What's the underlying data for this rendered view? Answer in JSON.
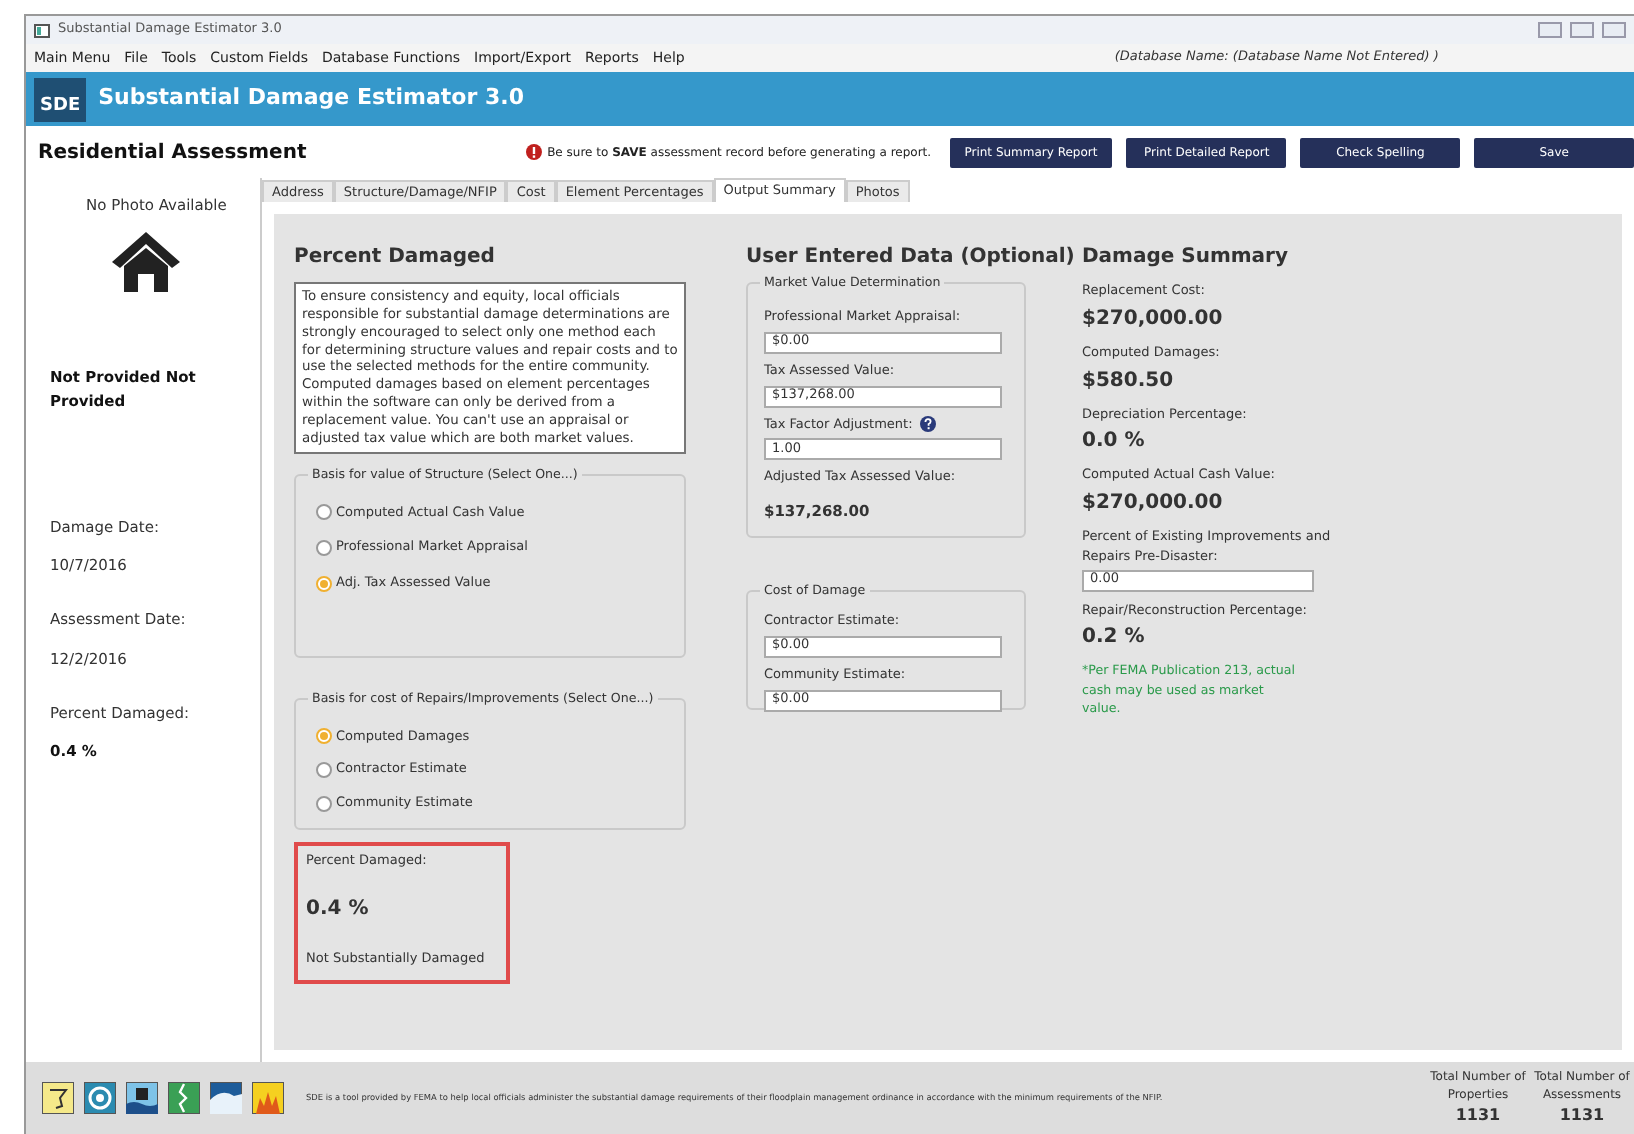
{
  "window": {
    "title": "Substantial Damage Estimator 3.0"
  },
  "menu": [
    "Main Menu",
    "File",
    "Tools",
    "Custom Fields",
    "Database Functions",
    "Import/Export",
    "Reports",
    "Help"
  ],
  "database_name": "(Database Name:  (Database Name Not Entered) )",
  "header": {
    "logo": "SDE",
    "title": "Substantial Damage Estimator 3.0"
  },
  "assessment": {
    "title": "Residential Assessment",
    "warning": "Be sure to **SAVE** assessment record before generating a report.",
    "buttons": [
      "Print Summary Report",
      "Print Detailed Report",
      "Check Spelling",
      "Save"
    ]
  },
  "tabs": [
    {
      "label": "Address",
      "selected": false
    },
    {
      "label": "Structure/Damage/NFIP",
      "selected": false
    },
    {
      "label": "Cost",
      "selected": false
    },
    {
      "label": "Element Percentages",
      "selected": false
    },
    {
      "label": "Output Summary",
      "selected": true
    },
    {
      "label": "Photos",
      "selected": false
    }
  ],
  "sidebar": {
    "photo_label": "No Photo Available",
    "owner": "Not Provided Not Provided",
    "fields": [
      {
        "label": "Damage Date:",
        "value": "10/7/2016",
        "bold": false
      },
      {
        "label": "Assessment Date:",
        "value": "12/2/2016",
        "bold": false
      },
      {
        "label": "Percent Damaged:",
        "value": "0.4 %",
        "bold": true
      }
    ]
  },
  "percent_damaged": {
    "heading": "Percent Damaged",
    "info": "To ensure consistency and equity, local officials responsible for substantial damage determinations are strongly encouraged to select only one method each for determining structure values and repair costs and to use the selected methods for the entire community. Computed damages based on element percentages within the software can only be derived from a replacement value. You can't use an appraisal or adjusted tax value which are both market values.",
    "groups": [
      {
        "legend": "Basis for value of Structure (Select One...)",
        "options": [
          {
            "label": "Computed Actual Cash Value",
            "selected": false
          },
          {
            "label": "Professional Market Appraisal",
            "selected": false
          },
          {
            "label": "Adj. Tax Assessed Value",
            "selected": true
          }
        ]
      },
      {
        "legend": "Basis for cost of Repairs/Improvements (Select One...)",
        "options": [
          {
            "label": "Computed Damages",
            "selected": true
          },
          {
            "label": "Contractor Estimate",
            "selected": false
          },
          {
            "label": "Community Estimate",
            "selected": false
          }
        ]
      }
    ],
    "result": {
      "label": "Percent Damaged:",
      "value": "0.4 %",
      "status": "Not Substantially Damaged"
    }
  },
  "user_data": {
    "heading": "User Entered Data (Optional)",
    "market": {
      "legend": "Market Value Determination",
      "fields": [
        {
          "label": "Professional Market Appraisal:",
          "value": "$0.00",
          "help": false
        },
        {
          "label": "Tax Assessed Value:",
          "value": "$137,268.00",
          "help": false
        },
        {
          "label": "Tax Factor Adjustment:",
          "value": "1.00",
          "help": true
        }
      ],
      "adjusted_label": "Adjusted Tax Assessed Value:",
      "adjusted_value": "$137,268.00"
    },
    "cost": {
      "legend": "Cost of Damage",
      "fields": [
        {
          "label": "Contractor Estimate:",
          "value": "$0.00"
        },
        {
          "label": "Community Estimate:",
          "value": "$0.00"
        }
      ]
    }
  },
  "summary": {
    "heading": "Damage Summary",
    "items": [
      {
        "kind": "value",
        "label": "Replacement Cost:",
        "value": "$270,000.00"
      },
      {
        "kind": "value",
        "label": "Computed Damages:",
        "value": "$580.50"
      },
      {
        "kind": "value",
        "label": "Depreciation Percentage:",
        "value": "0.0 %"
      },
      {
        "kind": "value",
        "label": "Computed Actual Cash Value:",
        "value": "$270,000.00"
      },
      {
        "kind": "input",
        "label": "Percent of Existing Improvements and Repairs Pre-Disaster:",
        "value": "0.00"
      },
      {
        "kind": "value",
        "label": "Repair/Reconstruction Percentage:",
        "value": "0.2 %"
      }
    ],
    "note": "*Per FEMA Publication 213, actual cash may be used as market value."
  },
  "footer": {
    "description": "SDE is a tool provided by FEMA to help local officials administer the substantial damage requirements of their floodplain management ordinance in accordance with the minimum requirements of the NFIP.",
    "counters": [
      {
        "label": "Total Number of Properties",
        "value": "1131"
      },
      {
        "label": "Total Number of Assessments",
        "value": "1131"
      }
    ]
  }
}
